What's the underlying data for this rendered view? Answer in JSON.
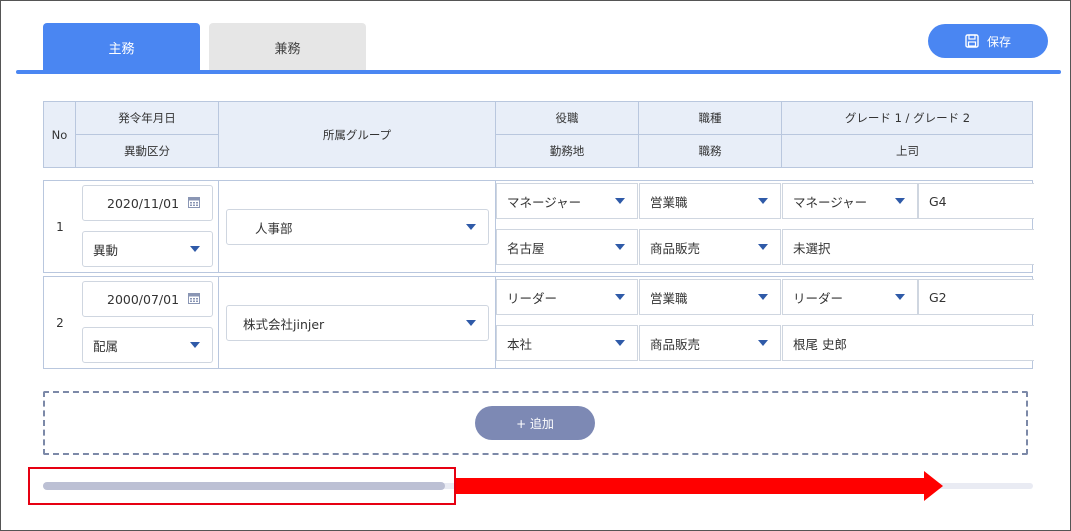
{
  "tabs": {
    "main_label": "主務",
    "sub_label": "兼務"
  },
  "save_button": {
    "label": "保存",
    "icon": "save-icon"
  },
  "table": {
    "headers": {
      "no": "No",
      "issue_date": "発令年月日",
      "change_type": "異動区分",
      "group": "所属グループ",
      "position": "役職",
      "work_location": "勤務地",
      "job_type": "職種",
      "duty": "職務",
      "grade": "グレード 1 / グレード 2",
      "supervisor": "上司"
    },
    "rows": [
      {
        "no": "1",
        "issue_date": "2020/11/01",
        "change_type": "異動",
        "group": "人事部",
        "position": "マネージャー",
        "work_location": "名古屋",
        "job_type": "営業職",
        "duty": "商品販売",
        "grade1": "マネージャー",
        "grade2": "G4",
        "supervisor": "未選択"
      },
      {
        "no": "2",
        "issue_date": "2000/07/01",
        "change_type": "配属",
        "group": "株式会社jinjer",
        "position": "リーダー",
        "work_location": "本社",
        "job_type": "営業職",
        "duty": "商品販売",
        "grade1": "リーダー",
        "grade2": "G2",
        "supervisor": "根尾 史郎"
      }
    ]
  },
  "add_button": {
    "label": "+ 追加"
  },
  "colors": {
    "accent": "#4a86f2",
    "header_bg": "#e8eef8",
    "add_button": "#7d89b4",
    "annotation": "#ff0000"
  }
}
